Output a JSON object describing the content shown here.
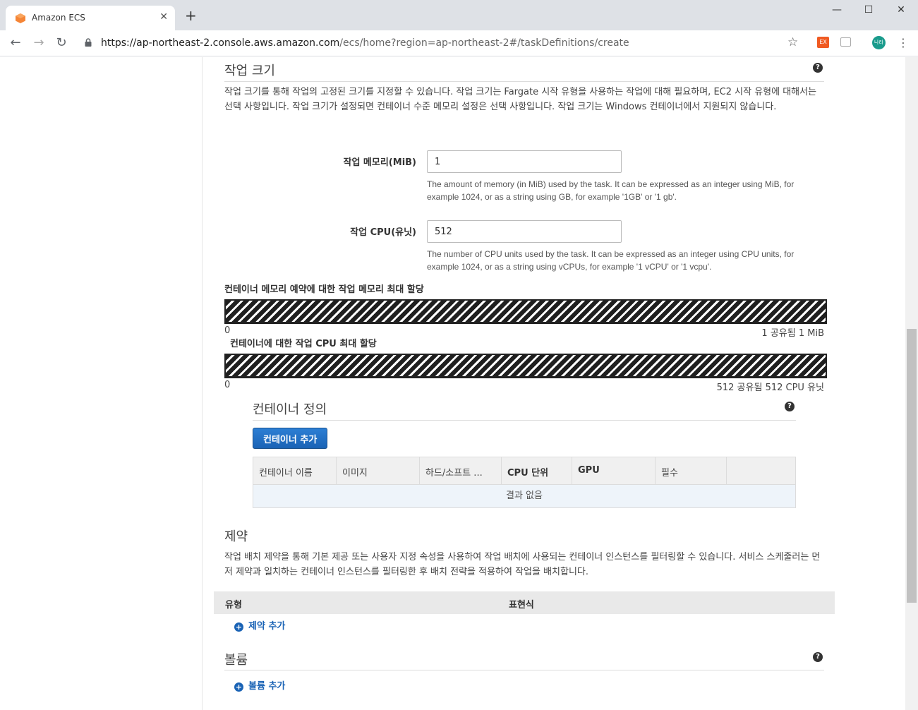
{
  "browser": {
    "tab_title": "Amazon ECS",
    "tab_close": "✕",
    "new_tab": "+",
    "window_controls": {
      "minimize": "—",
      "maximize": "☐",
      "close": "✕"
    },
    "url_host": "https://ap-northeast-2.console.aws.amazon.com",
    "url_path": "/ecs/home?region=ap-northeast-2#/taskDefinitions/create",
    "extension_label": "EX",
    "avatar_label": "나라",
    "icons": [
      "back-icon",
      "forward-icon",
      "reload-icon",
      "lock-icon",
      "star-icon",
      "menu-icon"
    ]
  },
  "task_size": {
    "title": "작업 크기",
    "help": "?",
    "description": "작업 크기를 통해 작업의 고정된 크기를 지정할 수 있습니다. 작업 크기는 Fargate 시작 유형을 사용하는 작업에 대해 필요하며, EC2 시작 유형에 대해서는 선택 사항입니다. 작업 크기가 설정되면 컨테이너 수준 메모리 설정은 선택 사항입니다. 작업 크기는 Windows 컨테이너에서 지원되지 않습니다.",
    "memory_label": "작업 메모리(MiB)",
    "memory_value": "1",
    "memory_hint": "The amount of memory (in MiB) used by the task. It can be expressed as an integer using MiB, for example 1024, or as a string using GB, for example '1GB' or '1 gb'.",
    "cpu_label": "작업 CPU(유닛)",
    "cpu_value": "512",
    "cpu_hint": "The number of CPU units used by the task. It can be expressed as an integer using CPU units, for example 1024, or as a string using vCPUs, for example '1 vCPU' or '1 vcpu'.",
    "memory_bar": {
      "label": "컨테이너 메모리 예약에 대한 작업 메모리 최대 할당",
      "min": "0",
      "max": "1 공유됨 1 MiB"
    },
    "cpu_bar": {
      "label": "컨테이너에 대한 작업 CPU 최대 할당",
      "min": "0",
      "max": "512 공유됨 512 CPU 유닛"
    }
  },
  "container_defs": {
    "title": "컨테이너 정의",
    "help": "?",
    "add_button": "컨테이너 추가",
    "columns": [
      "컨테이너 이름",
      "이미지",
      "하드/소프트 ...",
      "CPU 단위",
      "GPU",
      "필수",
      ""
    ],
    "empty_text": "결과 없음"
  },
  "constraints": {
    "title": "제약",
    "description": "작업 배치 제약을 통해 기본 제공 또는 사용자 지정 속성을 사용하여 작업 배치에 사용되는 컨테이너 인스턴스를 필터링할 수 있습니다. 서비스 스케줄러는 먼저 제약과 일치하는 컨테이너 인스턴스를 필터링한 후 배치 전략을 적용하여 작업을 배치합니다.",
    "col_type": "유형",
    "col_expression": "표현식",
    "add_link": "제약 추가",
    "plus": "+"
  },
  "volumes": {
    "title": "볼륨",
    "help": "?",
    "add_link": "볼륨 추가",
    "plus": "+"
  },
  "colors": {
    "primary_button": "#1a63b5",
    "link": "#1a63b5",
    "empty_row": "#eef4fa"
  }
}
